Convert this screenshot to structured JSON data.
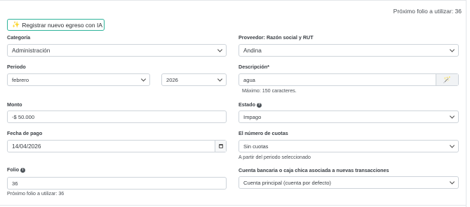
{
  "header": {
    "folio_text": "Próximo folio a utilizar: 36"
  },
  "ai_button": {
    "icon": "sparkles-icon",
    "label": "Registrar nuevo egreso con IA"
  },
  "categoria": {
    "label": "Categoría",
    "value": "Administración"
  },
  "proveedor": {
    "label": "Proveedor: Razón social y RUT",
    "value": "Andina"
  },
  "periodo": {
    "label": "Periodo",
    "month": "febrero",
    "year": "2026"
  },
  "descripcion": {
    "label": "Descripción*",
    "value": "agua",
    "hint": "Máximo: 150 caracteres.",
    "icon": "magic-wand-icon"
  },
  "monto": {
    "label": "Monto",
    "value": "-$ 50.000"
  },
  "estado": {
    "label": "Estado",
    "value": "Impago",
    "icon": "info-icon"
  },
  "fecha_pago": {
    "label": "Fecha de pago",
    "value": "14/04/2026",
    "icon": "calendar-icon"
  },
  "cuotas": {
    "label": "El número de cuotas",
    "value": "Sin cuotas",
    "hint": "A partir del periodo seleccionado"
  },
  "folio": {
    "label": "Folio",
    "value": "36",
    "hint": "Próximo folio a utilizar: 36",
    "icon": "info-icon"
  },
  "cuenta": {
    "label": "Cuenta bancaria o caja chica asociada a nuevas transacciones",
    "value": "Cuenta principal (cuenta por defecto)"
  }
}
